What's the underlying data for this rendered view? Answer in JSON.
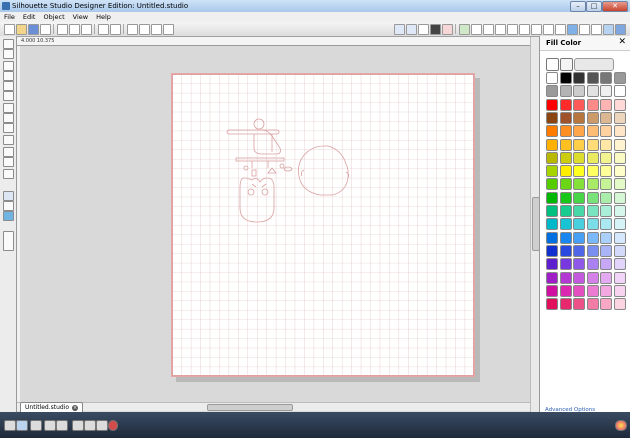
{
  "window": {
    "title": "Silhouette Studio Designer Edition: Untitled.studio",
    "buttons": [
      "–",
      "□",
      "✕"
    ]
  },
  "menu": [
    "File",
    "Edit",
    "Object",
    "View",
    "Help"
  ],
  "ruler_label": "4.000 10.375",
  "document_tab": {
    "label": "Untitled.studio"
  },
  "panel": {
    "title": "Fill Color",
    "close": "✕",
    "advanced_link": "Advanced Options",
    "palette": [
      [
        "#ffffff",
        "#000000",
        "#333333",
        "#555555",
        "#777777",
        "#999999"
      ],
      [
        "#9a9a9a",
        "#b4b4b4",
        "#cccccc",
        "#e2e2e2",
        "#f0f0f0",
        "#ffffff"
      ],
      [
        "#ff0000",
        "#ff2a2a",
        "#ff5a5a",
        "#ff8a8a",
        "#ffb4b4",
        "#ffd8d8"
      ],
      [
        "#8b4513",
        "#a0522d",
        "#b8763f",
        "#cd9a6a",
        "#dbb892",
        "#eed6bd"
      ],
      [
        "#ff7b00",
        "#ff8f22",
        "#ffa54a",
        "#ffbc75",
        "#ffd2a0",
        "#ffe6c8"
      ],
      [
        "#ffb000",
        "#ffc020",
        "#ffcf4a",
        "#ffdc78",
        "#ffe8a5",
        "#fff3d0"
      ],
      [
        "#b8b800",
        "#cccc10",
        "#dddd30",
        "#eaea60",
        "#f3f390",
        "#fafac4"
      ],
      [
        "#a6d400",
        "#ffee00",
        "#ffff20",
        "#ffff60",
        "#ffff9a",
        "#ffffcc"
      ],
      [
        "#55cc00",
        "#6ad614",
        "#86e03a",
        "#a6ea66",
        "#c6f396",
        "#e3f9c8"
      ],
      [
        "#00b800",
        "#18c818",
        "#48d648",
        "#7ae27a",
        "#aaedaa",
        "#d6f7d6"
      ],
      [
        "#00c080",
        "#18cc90",
        "#48d8a8",
        "#7ae4c0",
        "#aaefd8",
        "#d6f7ec"
      ],
      [
        "#00b8c8",
        "#18c4d4",
        "#48d0de",
        "#7adde8",
        "#aae9f1",
        "#d6f4f8"
      ],
      [
        "#0070e0",
        "#1888f0",
        "#48a0f4",
        "#7ab8f7",
        "#aad0fa",
        "#d6e8fd"
      ],
      [
        "#1030d0",
        "#2848e0",
        "#5068e8",
        "#7a8ef0",
        "#a8b4f6",
        "#d4daf9"
      ],
      [
        "#6020d0",
        "#7838e0",
        "#9058e8",
        "#ab80f0",
        "#c6a8f6",
        "#e2d4fa"
      ],
      [
        "#a020c8",
        "#b438d4",
        "#c45ade",
        "#d482e8",
        "#e4aaf1",
        "#f2d4f8"
      ],
      [
        "#d010a0",
        "#dc28b0",
        "#e450c0",
        "#ec7cd2",
        "#f3a8e2",
        "#f9d4f1"
      ],
      [
        "#e0105a",
        "#e8286e",
        "#ee5088",
        "#f37ca6",
        "#f8a8c4",
        "#fbd4e2"
      ]
    ]
  },
  "icons": [
    "new-document-icon",
    "open-icon",
    "save-icon",
    "print-icon",
    "undo-icon",
    "redo-icon",
    "zoom-in-icon",
    "zoom-out-icon",
    "zoom-fit-icon",
    "pan-icon",
    "select-tool-icon",
    "line-tool-icon",
    "rectangle-tool-icon",
    "ellipse-tool-icon",
    "polygon-tool-icon",
    "curve-tool-icon",
    "text-tool-icon",
    "eraser-tool-icon",
    "knife-tool-icon",
    "fill-color-icon",
    "line-color-icon",
    "cut-settings-icon",
    "send-to-silhouette-icon",
    "library-icon",
    "store-icon"
  ],
  "colors": {
    "accent": "#2a5db0",
    "grid_line": "#d8b4b4",
    "shape_stroke": "#d9a0a0",
    "statusbar": "#1e2a3a"
  }
}
